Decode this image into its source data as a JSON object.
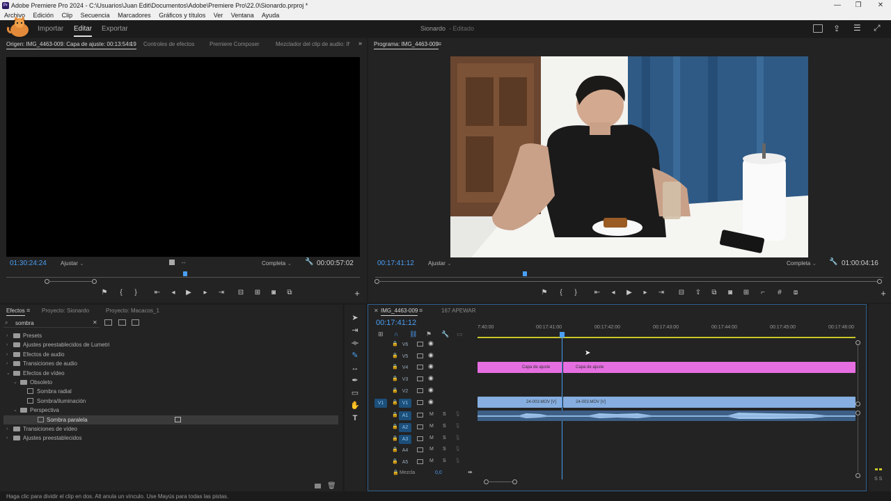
{
  "window": {
    "title": "Adobe Premiere Pro 2024 - C:\\Usuarios\\Juan Edit\\Documentos\\Adobe\\Premiere Pro\\22.0\\Sionardo.prproj *",
    "app_badge": "Pr"
  },
  "menu": [
    "Archivo",
    "Edición",
    "Clip",
    "Secuencia",
    "Marcadores",
    "Gráficos y títulos",
    "Ver",
    "Ventana",
    "Ayuda"
  ],
  "header": {
    "modes": [
      "Importar",
      "Editar",
      "Exportar"
    ],
    "active_mode": "Editar",
    "project": "Sionardo",
    "status": "- Editado"
  },
  "source": {
    "tabs": [
      "Origen: IMG_4463-009: Capa de ajuste: 00:13:54:19",
      "Controles de efectos",
      "Premiere Composer",
      "Mezclador del clip de audio: IMG"
    ],
    "timecode": "01:30:24:24",
    "fit": "Ajustar",
    "quality": "Completa",
    "duration": "00:00:57:02"
  },
  "program": {
    "tab": "Programa: IMG_4463-009",
    "timecode": "00:17:41:12",
    "fit": "Ajustar",
    "quality": "Completa",
    "duration": "01:00:04:16",
    "playhead_fraction": 0.29
  },
  "effects": {
    "tabs": [
      "Efectos",
      "Proyecto: Sionardo",
      "Proyecto: Macacos_1"
    ],
    "search_value": "sombra",
    "tree": [
      {
        "label": "Presets",
        "depth": 0,
        "kind": "folder",
        "arrow": "›"
      },
      {
        "label": "Ajustes preestablecidos de Lumetri",
        "depth": 0,
        "kind": "folder",
        "arrow": "›"
      },
      {
        "label": "Efectos de audio",
        "depth": 0,
        "kind": "folder",
        "arrow": "›"
      },
      {
        "label": "Transiciones de audio",
        "depth": 0,
        "kind": "folder",
        "arrow": "›"
      },
      {
        "label": "Efectos de vídeo",
        "depth": 0,
        "kind": "folder",
        "arrow": "⌄"
      },
      {
        "label": "Obsoleto",
        "depth": 1,
        "kind": "folder",
        "arrow": "⌄"
      },
      {
        "label": "Sombra radial",
        "depth": 2,
        "kind": "fx",
        "arrow": ""
      },
      {
        "label": "Sombra/iluminación",
        "depth": 2,
        "kind": "fx",
        "arrow": ""
      },
      {
        "label": "Perspectiva",
        "depth": 1,
        "kind": "folder",
        "arrow": "⌄"
      },
      {
        "label": "Sombra paralela",
        "depth": 2,
        "kind": "fx",
        "arrow": "",
        "selected": true
      },
      {
        "label": "Transiciones de vídeo",
        "depth": 0,
        "kind": "folder",
        "arrow": "›"
      },
      {
        "label": "Ajustes preestablecidos",
        "depth": 0,
        "kind": "folder",
        "arrow": "›"
      }
    ]
  },
  "timeline": {
    "tabs": [
      "IMG_4463-009",
      "167 APEWAR"
    ],
    "timecode": "00:17:41:12",
    "ruler": [
      "7:40:00",
      "00:17:41:00",
      "00:17:42:00",
      "00:17:43:00",
      "00:17:44:00",
      "00:17:45:00",
      "00:17:46:00"
    ],
    "video_tracks": [
      "V6",
      "V5",
      "V4",
      "V3",
      "V2",
      "V1"
    ],
    "audio_tracks": [
      "A1",
      "A2",
      "A3",
      "A4",
      "A5"
    ],
    "source_patch": "V1",
    "mix_label": "Mezcla",
    "mix_value": "0,0",
    "mute_label": "M",
    "solo_label": "S",
    "clips": {
      "adj_a": "Capa de ajuste",
      "adj_b": "Capa de ajuste",
      "vid_a": "24-003.MOV [V]",
      "vid_b": "24-003.MOV [V]"
    },
    "meter_labels": "S S"
  },
  "status_bar": "Haga clic para dividir el clip en dos. Alt anula un vínculo. Use Mayús para todas las pistas.",
  "colors": {
    "accent": "#4a9ff5",
    "adjustment_clip": "#e56ee0",
    "video_clip": "#86aee0",
    "audio_clip": "#3d5f86"
  }
}
